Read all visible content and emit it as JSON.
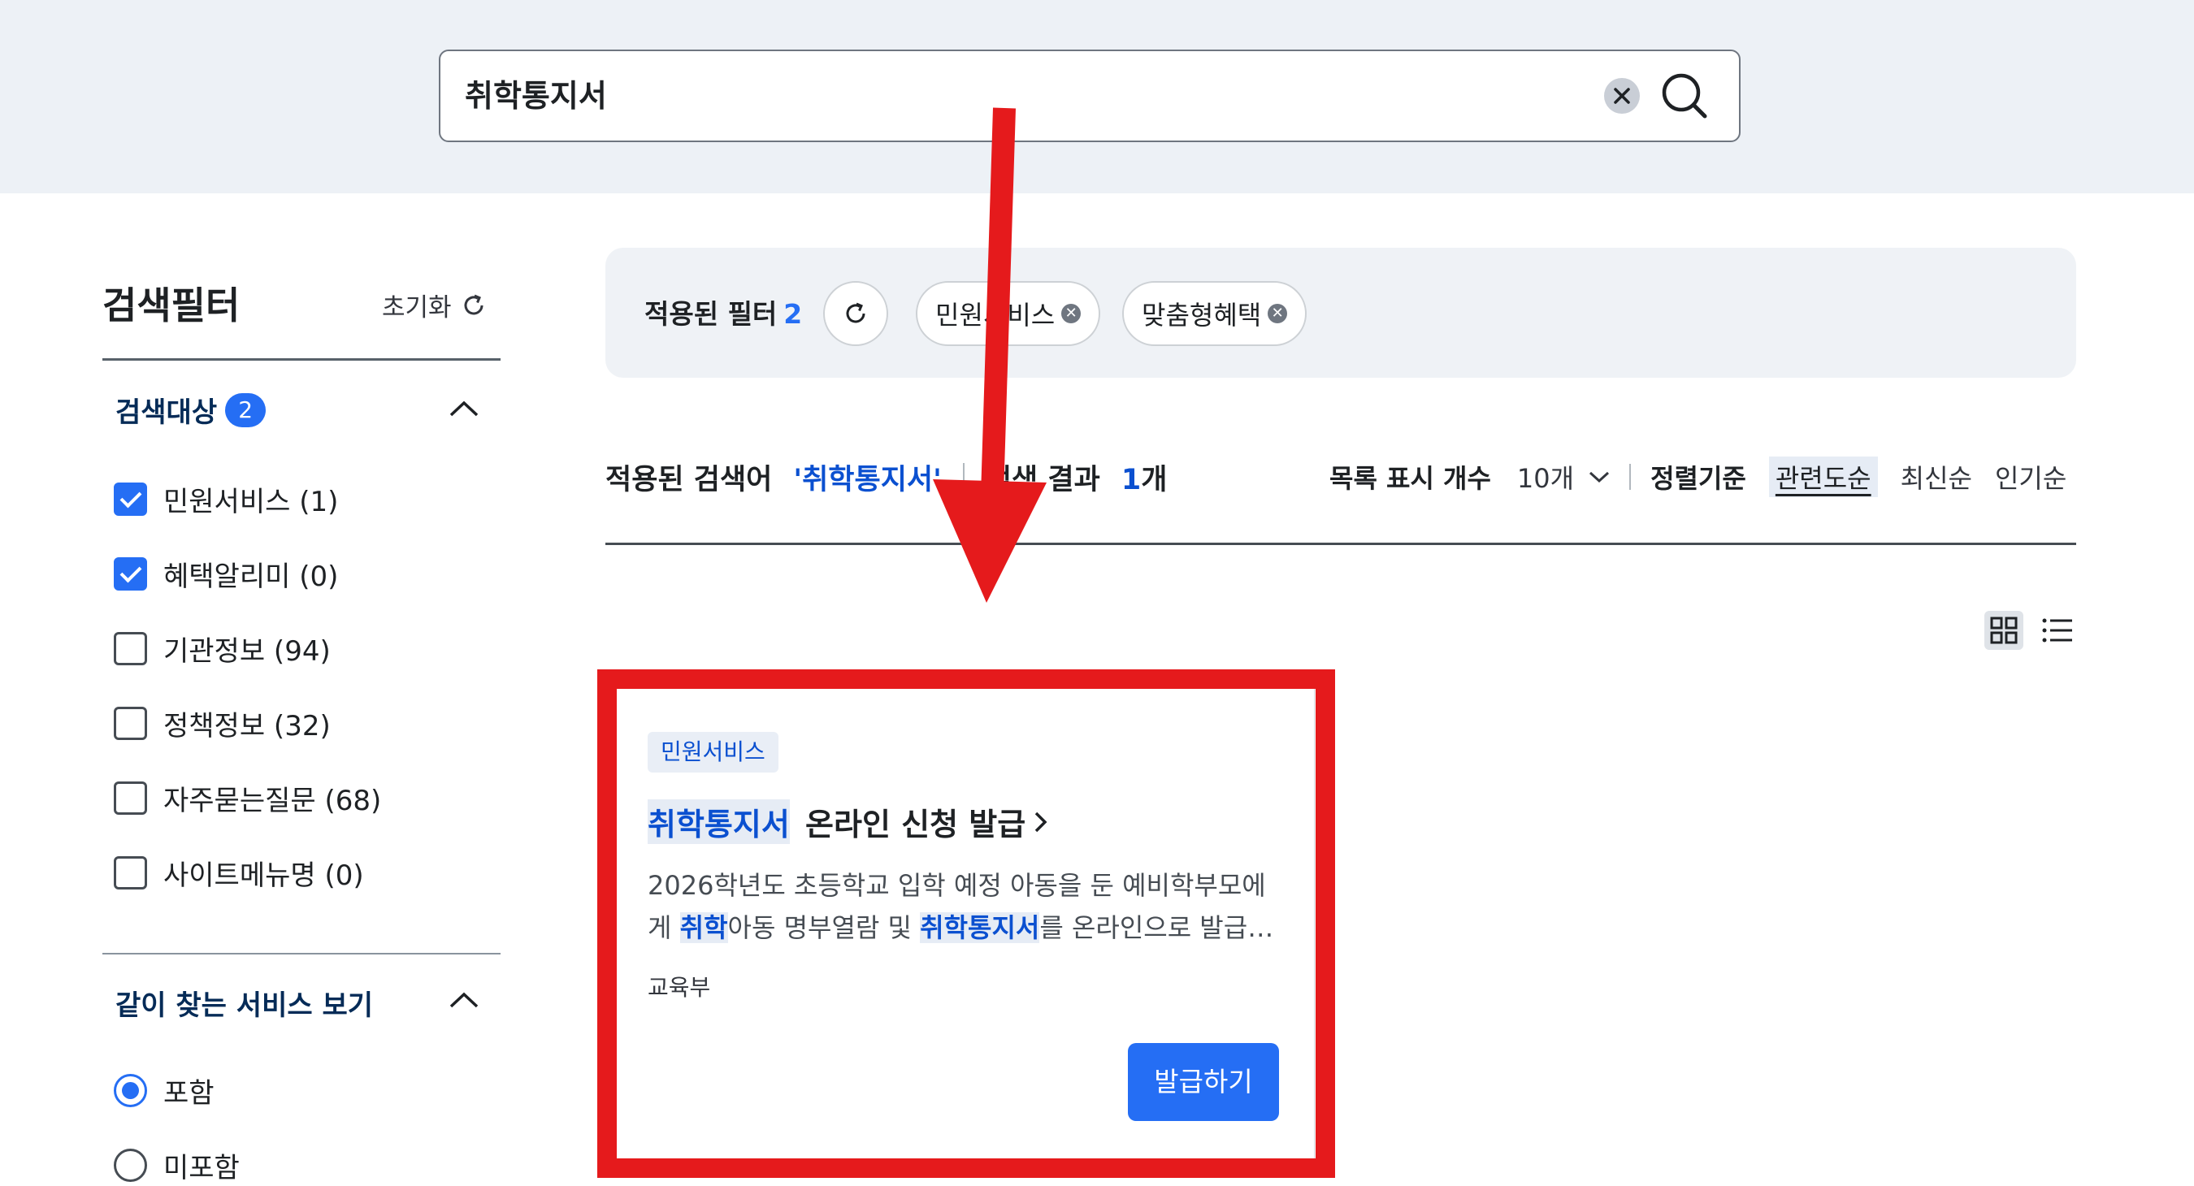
{
  "search": {
    "value": "취학통지서",
    "icons": {
      "clear": "clear-circle-icon",
      "submit": "search-icon"
    }
  },
  "sidebar": {
    "title": "검색필터",
    "reset_label": "초기화",
    "target_section": {
      "title": "검색대상",
      "count": "2",
      "options": [
        {
          "label": "민원서비스 (1)",
          "checked": true
        },
        {
          "label": "혜택알리미 (0)",
          "checked": true
        },
        {
          "label": "기관정보 (94)",
          "checked": false
        },
        {
          "label": "정책정보 (32)",
          "checked": false
        },
        {
          "label": "자주묻는질문 (68)",
          "checked": false
        },
        {
          "label": "사이트메뉴명 (0)",
          "checked": false
        }
      ]
    },
    "related_section": {
      "title": "같이 찾는 서비스 보기",
      "options": [
        {
          "label": "포함",
          "selected": true
        },
        {
          "label": "미포함",
          "selected": false
        }
      ]
    }
  },
  "applied_filters": {
    "label": "적용된 필터",
    "count": "2",
    "chips": [
      {
        "label": "민원서비스"
      },
      {
        "label": "맞춤형혜택"
      }
    ]
  },
  "results_bar": {
    "query_label": "적용된 검색어",
    "query_value": "'취학통지서'",
    "result_label": "검색 결과",
    "result_count": "1",
    "result_unit": "개",
    "page_size_label": "목록 표시 개수",
    "page_size_value": "10개",
    "sort_label": "정렬기준",
    "sort_options": [
      "관련도순",
      "최신순",
      "인기순"
    ],
    "active_sort": "관련도순"
  },
  "result_card": {
    "tag": "민원서비스",
    "title_highlight": "취학통지서",
    "title_rest": " 온라인 신청 발급",
    "desc_part1": "2026학년도 초등학교 입학 예정 아동을 둔 예비학부모에게 ",
    "desc_hl1": "취학",
    "desc_part2": "아동 명부열람 및 ",
    "desc_hl2": "취학통지서",
    "desc_part3": "를 온라인으로 발급…",
    "org": "교육부",
    "button_label": "발급하기"
  },
  "colors": {
    "accent": "#256ef4",
    "highlight_text": "#0b50d0",
    "annotation_red": "#e51a1c",
    "band_bg": "#edf1f6"
  }
}
